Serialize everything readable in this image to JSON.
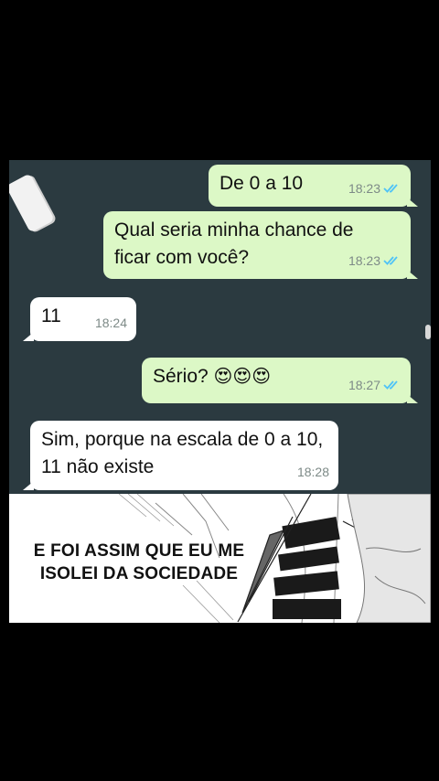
{
  "messages": [
    {
      "direction": "out",
      "text": "De 0 a 10",
      "time": "18:23",
      "read": true
    },
    {
      "direction": "out",
      "text": "Qual seria minha chance de ficar com você?",
      "time": "18:23",
      "read": true
    },
    {
      "direction": "in",
      "text": "11",
      "time": "18:24"
    },
    {
      "direction": "out",
      "text": "Sério?",
      "emoji": "😍😍😍",
      "time": "18:27",
      "read": true
    },
    {
      "direction": "in",
      "text": "Sim, porque na escala de 0 a 10, 11 não existe",
      "time": "18:28"
    }
  ],
  "meme": {
    "caption_line1": "E FOI ASSIM QUE EU ME",
    "caption_line2": "ISOLEI DA SOCIEDADE"
  },
  "colors": {
    "chat_background": "#2b3a40",
    "outgoing_bubble": "#dcf8c6",
    "incoming_bubble": "#ffffff",
    "read_ticks": "#4fc3f7"
  },
  "icons": {
    "read_receipt": "double-check-icon"
  }
}
